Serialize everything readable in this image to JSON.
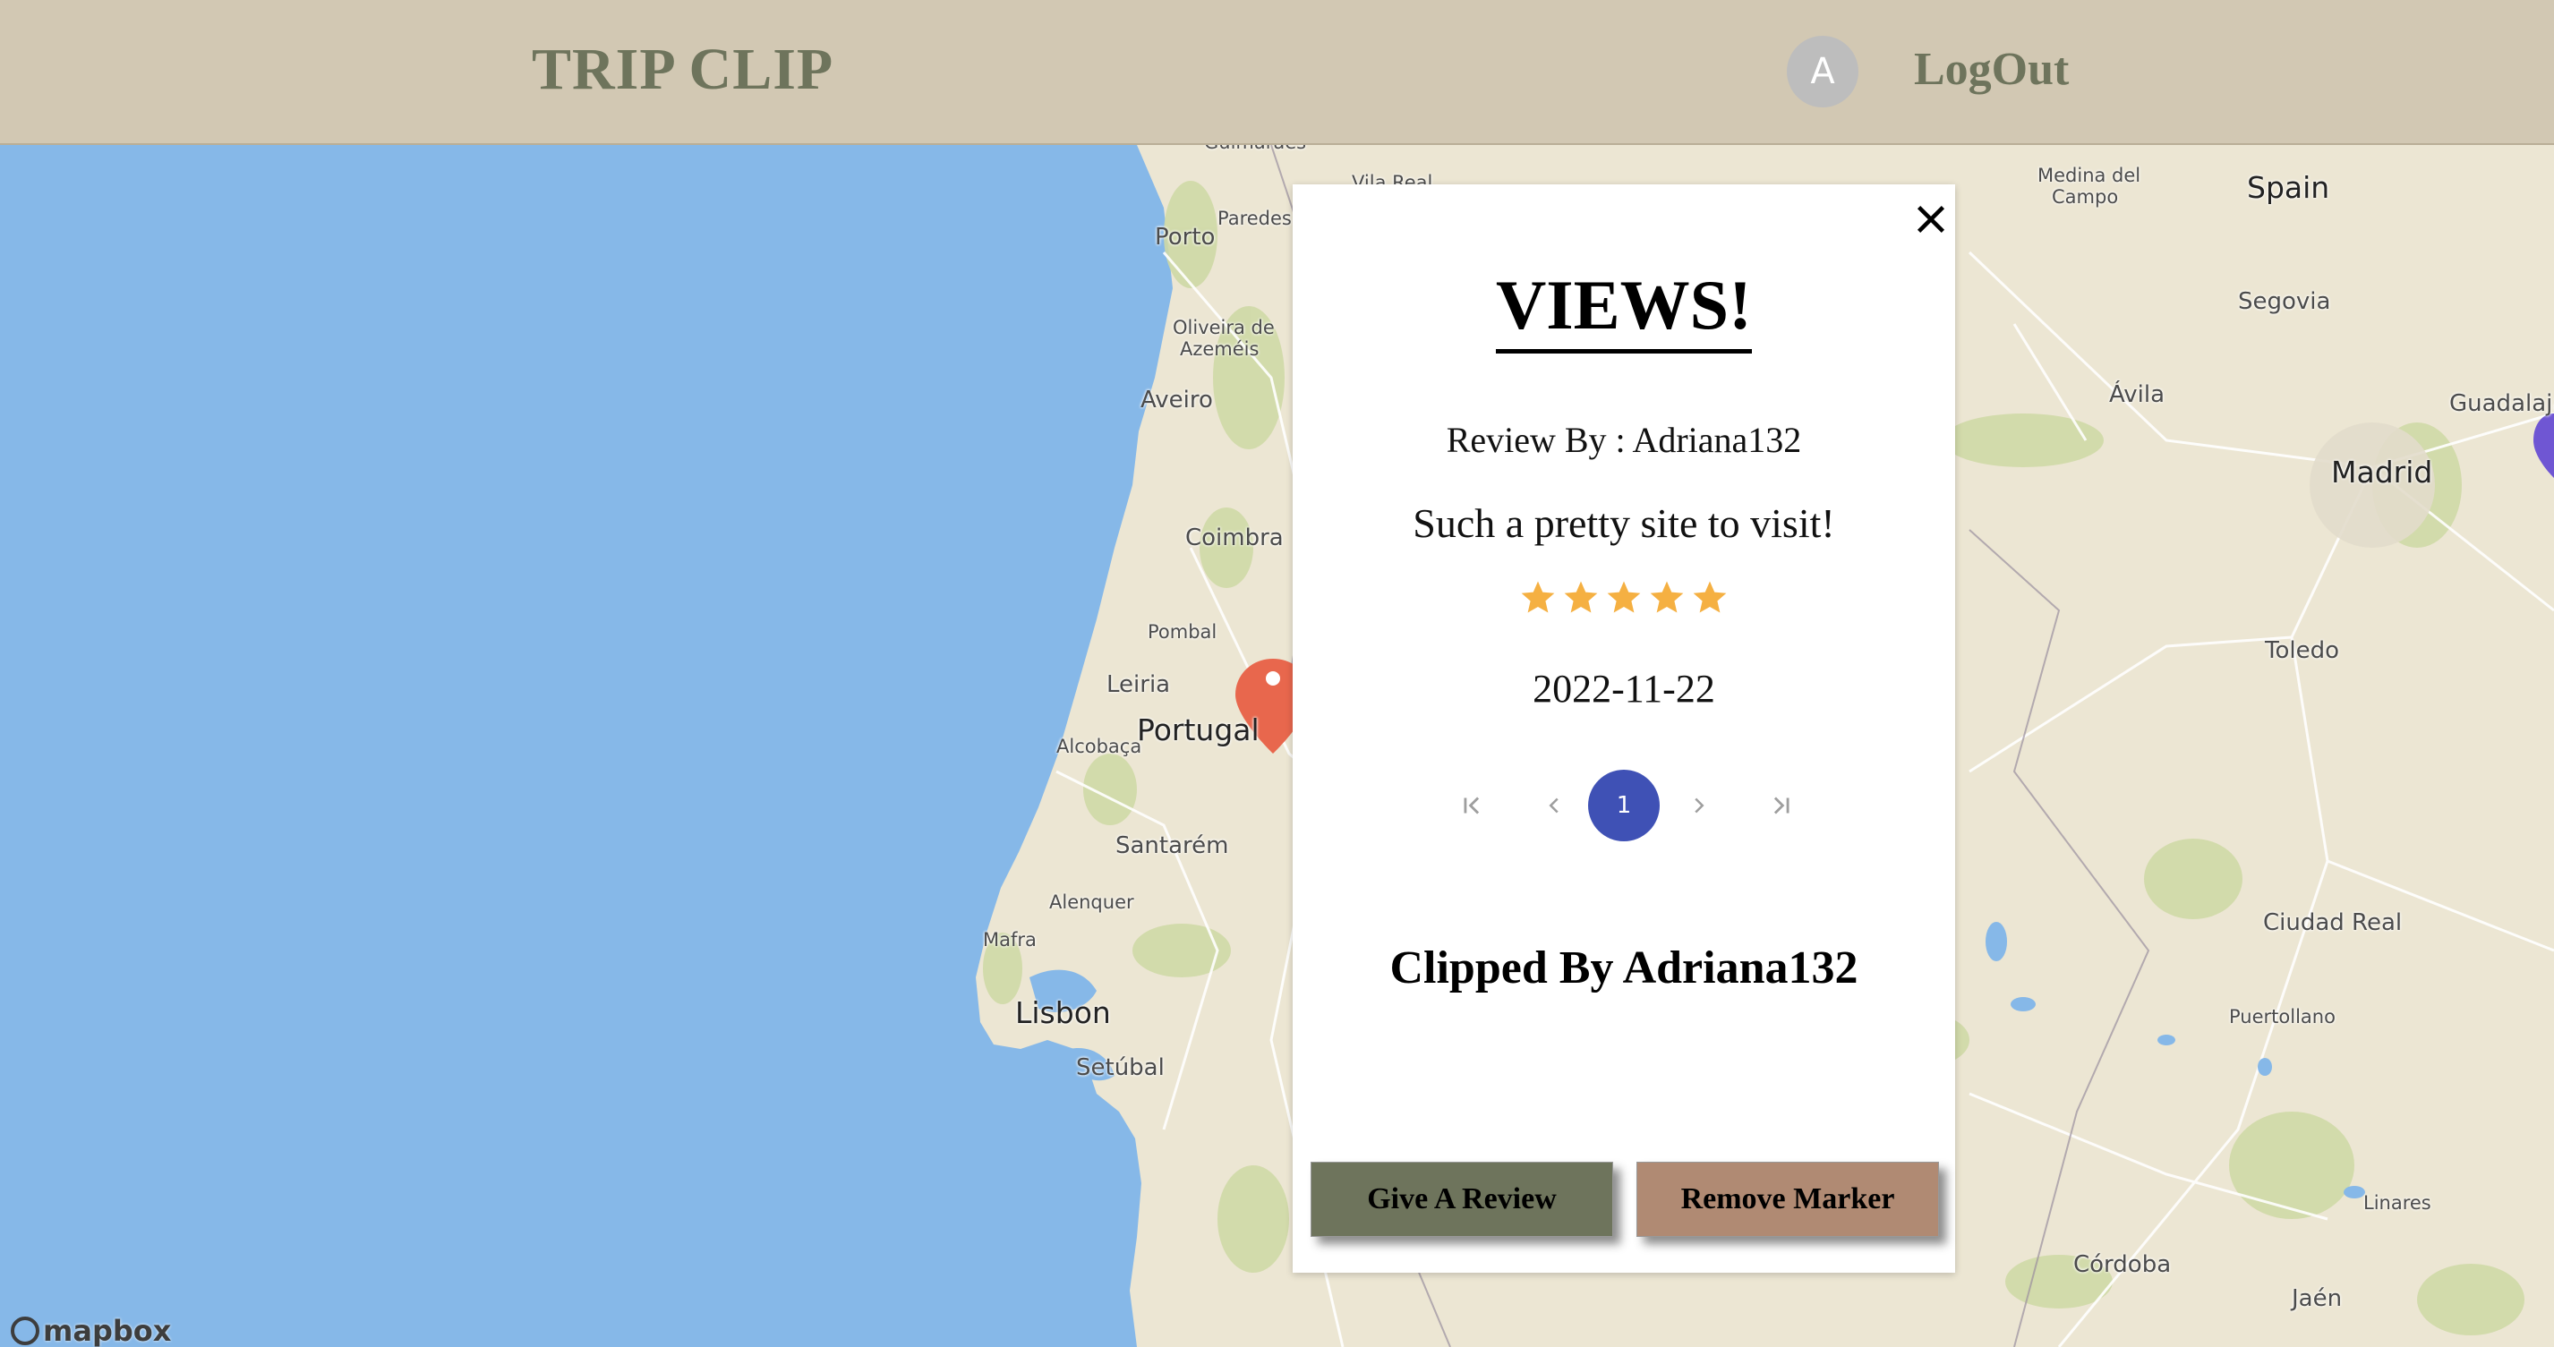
{
  "header": {
    "brand": "TRIP CLIP",
    "avatar_letter": "A",
    "logout_label": "LogOut"
  },
  "map": {
    "attribution": "mapbox",
    "labels": [
      {
        "text": "Guimarães",
        "size": "sm"
      },
      {
        "text": "Vila Real",
        "size": "sm"
      },
      {
        "text": "Paredes",
        "size": "sm"
      },
      {
        "text": "Porto",
        "size": "md"
      },
      {
        "text": "Oliveira de",
        "size": "sm"
      },
      {
        "text": "Azeméis",
        "size": "sm"
      },
      {
        "text": "Aveiro",
        "size": "md"
      },
      {
        "text": "Coimbra",
        "size": "md"
      },
      {
        "text": "Pombal",
        "size": "sm"
      },
      {
        "text": "Leiria",
        "size": "md"
      },
      {
        "text": "Portugal",
        "size": "lg"
      },
      {
        "text": "Alcobaça",
        "size": "sm"
      },
      {
        "text": "Santarém",
        "size": "md"
      },
      {
        "text": "Alenquer",
        "size": "sm"
      },
      {
        "text": "Mafra",
        "size": "sm"
      },
      {
        "text": "Lisbon",
        "size": "lg"
      },
      {
        "text": "Setúbal",
        "size": "md"
      },
      {
        "text": "Medina del",
        "size": "sm"
      },
      {
        "text": "Campo",
        "size": "sm"
      },
      {
        "text": "Spain",
        "size": "lg"
      },
      {
        "text": "Segovia",
        "size": "md"
      },
      {
        "text": "Ávila",
        "size": "md"
      },
      {
        "text": "Guadalajara",
        "size": "md"
      },
      {
        "text": "Madrid",
        "size": "lg"
      },
      {
        "text": "Toledo",
        "size": "md"
      },
      {
        "text": "Ciudad Real",
        "size": "md"
      },
      {
        "text": "Puertollano",
        "size": "sm"
      },
      {
        "text": "Linares",
        "size": "sm"
      },
      {
        "text": "Córdoba",
        "size": "md"
      },
      {
        "text": "Jaén",
        "size": "md"
      }
    ],
    "colors": {
      "water": "#86b8e8",
      "land": "#ece6d3",
      "park": "#cfd9a6",
      "marker_red": "#e8674d",
      "marker_purple": "#6f56d3"
    }
  },
  "popup": {
    "title": "VIEWS!",
    "review_by": "Review By : Adriana132",
    "review_text": "Such a pretty site to visit!",
    "rating": 5,
    "rating_max": 5,
    "date": "2022-11-22",
    "pagination": {
      "current_page": "1"
    },
    "clipped_by": "Clipped By Adriana132",
    "give_review_label": "Give A Review",
    "remove_marker_label": "Remove Marker",
    "colors": {
      "star": "#f5b042",
      "pager_active": "#3f51b5"
    }
  }
}
